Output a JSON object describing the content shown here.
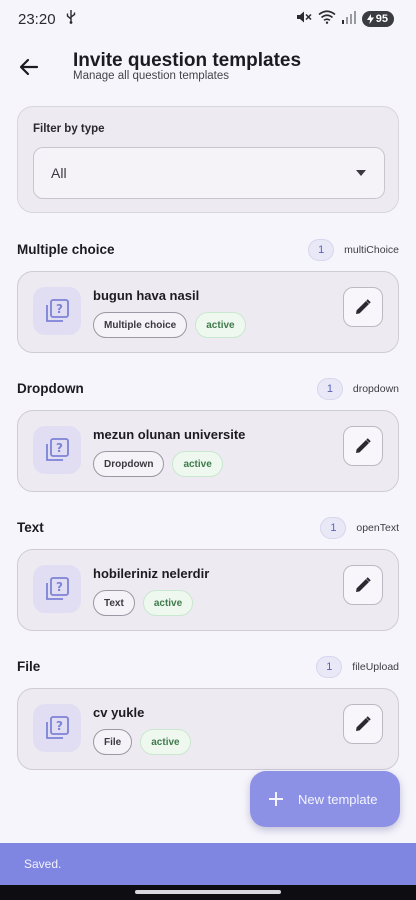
{
  "status_bar": {
    "time": "23:20",
    "battery": "95"
  },
  "header": {
    "title": "Invite question templates",
    "subtitle": "Manage all question templates"
  },
  "filter": {
    "label": "Filter by type",
    "value": "All"
  },
  "sections": [
    {
      "title": "Multiple choice",
      "count": "1",
      "type_key": "multiChoice",
      "item": {
        "title": "bugun hava nasil",
        "type_chip": "Multiple choice",
        "status_chip": "active"
      }
    },
    {
      "title": "Dropdown",
      "count": "1",
      "type_key": "dropdown",
      "item": {
        "title": "mezun olunan universite",
        "type_chip": "Dropdown",
        "status_chip": "active"
      }
    },
    {
      "title": "Text",
      "count": "1",
      "type_key": "openText",
      "item": {
        "title": "hobileriniz nelerdir",
        "type_chip": "Text",
        "status_chip": "active"
      }
    },
    {
      "title": "File",
      "count": "1",
      "type_key": "fileUpload",
      "item": {
        "title": "cv yukle",
        "type_chip": "File",
        "status_chip": "active"
      }
    }
  ],
  "fab": {
    "label": "New template",
    "icon": "plus-icon"
  },
  "snackbar": {
    "text": "Saved."
  },
  "colors": {
    "accent": "#8c91e6",
    "snackbar": "#7f86e2",
    "active_chip_text": "#3f7a4b",
    "card_bg": "#eeeaf2"
  },
  "icons": {
    "back": "arrow-left-icon",
    "item": "question-library-icon",
    "edit": "pencil-icon",
    "dropdown": "caret-down-icon"
  }
}
